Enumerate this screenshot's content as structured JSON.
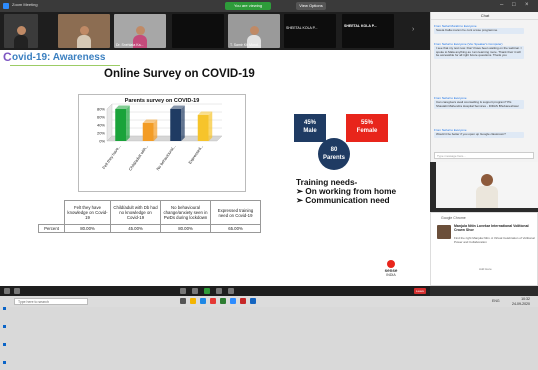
{
  "titlebar": {
    "app_title": "Zoom Meeting",
    "recording_label": "You are viewing",
    "view_label": "View Options"
  },
  "video_strip": {
    "tiles": [
      {
        "caption": ""
      },
      {
        "caption": ""
      },
      {
        "caption": "Dr. Snehlata Ka..."
      },
      {
        "caption": ""
      },
      {
        "caption": "T. Samir Kh Mond..."
      },
      {
        "caption": "SHEETAL KOLA P..."
      }
    ]
  },
  "slide": {
    "logo_letter": "C",
    "title": "ovid-19: Awareness",
    "survey_title": "Online Survey on COVID-19",
    "chart_data": {
      "type": "bar",
      "title": "Parents survey on COVID-19",
      "categories": [
        "Felt they have...",
        "Child/adult with...",
        "No behavioural...",
        "Expressed..."
      ],
      "values": [
        80,
        45,
        80,
        65
      ],
      "ylim": [
        0,
        80
      ],
      "yticks": [
        "80%",
        "60%",
        "40%",
        "20%",
        "0%"
      ],
      "colors": [
        "#1aa33a",
        "#f39c25",
        "#1f3b63",
        "#f6c42b"
      ],
      "three_d": true
    },
    "table": {
      "headers": [
        "",
        "Felt they have knowledge on Covid-19",
        "Child/adult with Db had no knowledge on Covid-19",
        "No behavioural change/anxiety seen in PwDs during lockdown",
        "Expressed training need on Covid-19"
      ],
      "row_label": "Percent",
      "values": [
        "80.00%",
        "45.00%",
        "80.00%",
        "65.00%"
      ]
    },
    "male": {
      "pct": "45%",
      "label": "Male",
      "color": "#1f3b63"
    },
    "female": {
      "pct": "55%",
      "label": "Female",
      "color": "#e8251b"
    },
    "parents": {
      "count": "80",
      "label": "Parents"
    },
    "training": {
      "heading": "Training needs-",
      "items": [
        "On working from home",
        "Communication need"
      ]
    },
    "logo": {
      "line1": "sense",
      "line2": "INDIA"
    }
  },
  "chat": {
    "header": "Chat",
    "messages": [
      {
        "from": "From Nehal Murabi to Everyone",
        "text": "Sweta Kalla ma'am he cont a lose programme"
      },
      {
        "from": "From Nehal to Everyone (Via: Speaker's Computer)",
        "text": "I see that my text now. Don't have been waiting on the webinar. I spoke to Mala anything as I am learning more. Thank their it will be accessible for all right future questions. Thank you"
      },
      {
        "from": "From Nehal to Everyone",
        "text": "Can caregivers avail counselling & support program? Pls Shastabi Mahendra Hospital Services - DIDAS Bhubaneshwar"
      },
      {
        "from": "From Nehal to Everyone",
        "text": "Would it be better if you open up Google classroom?"
      }
    ],
    "input_placeholder": "Type message here..."
  },
  "notification": {
    "header": "Google Chrome",
    "title": "Manjula Nitin Lovekar International Volitional Crown Shor",
    "subtitle": "Find the right Manjula Nitin. A Virtual Celebration of Volitional Power and Collaboration",
    "meta": "Add Here"
  },
  "taskbar": {
    "search_placeholder": "Type here to search",
    "time": "10:32",
    "date": "24-09-2020",
    "lang": "ENG"
  }
}
